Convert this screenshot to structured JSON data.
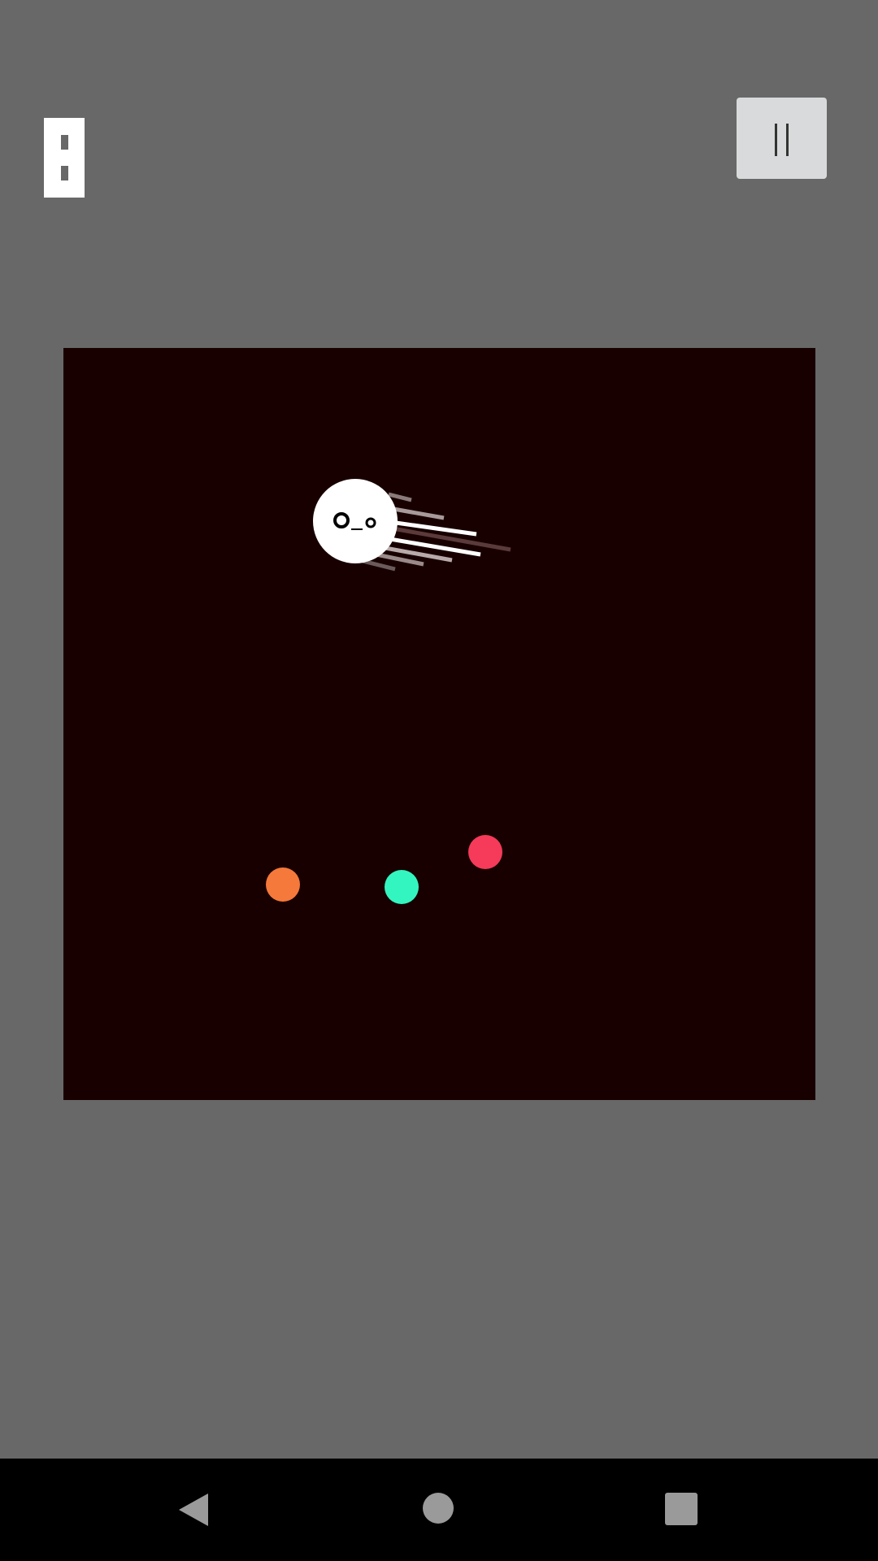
{
  "game": {
    "background_color": "#686868",
    "arena_color": "#180000",
    "player": {
      "color": "#ffffff",
      "face": "O_o"
    },
    "dots": [
      {
        "name": "orange-dot",
        "color": "#f5793a"
      },
      {
        "name": "green-dot",
        "color": "#33f5c0"
      },
      {
        "name": "red-dot",
        "color": "#f53a5a"
      }
    ]
  },
  "hud": {
    "score_icon": "score-indicator-icon",
    "pause_icon": "pause-icon"
  },
  "nav": {
    "back_icon": "back-triangle-icon",
    "home_icon": "home-circle-icon",
    "recents_icon": "recents-square-icon"
  }
}
